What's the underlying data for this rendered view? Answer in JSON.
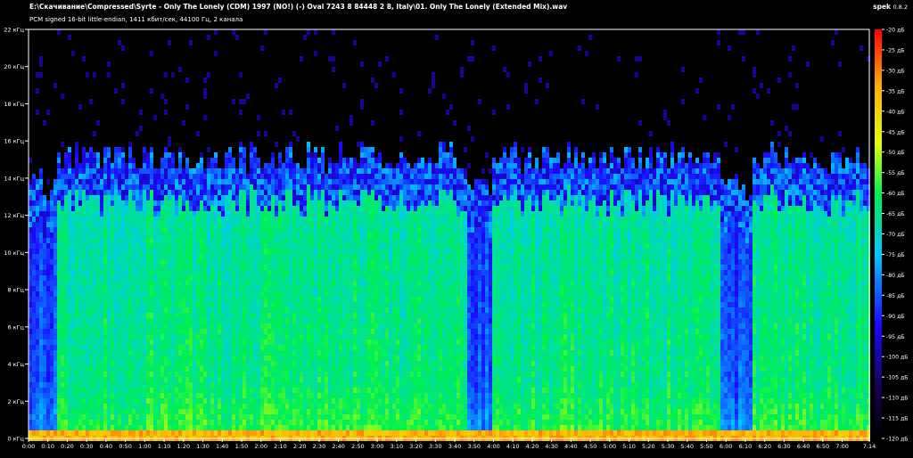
{
  "header": {
    "title": "E:\\Скачивание\\Compressed\\Syrte - Only The Lonely (CDM) 1997 (NO!) (-) Oval  7243 8 84448 2 8, Italy\\01. Only The Lonely (Extended Mix).wav",
    "subtitle": "PCM signed 16-bit little-endian, 1411 кбит/сек, 44100 Гц, 2 канала",
    "app_name": "spek",
    "app_version": "0.8.2"
  },
  "chart_data": {
    "type": "heatmap",
    "x_ticks": [
      "0:00",
      "0:10",
      "0:20",
      "0:30",
      "0:40",
      "0:50",
      "1:00",
      "1:10",
      "1:20",
      "1:30",
      "1:40",
      "1:50",
      "2:00",
      "2:10",
      "2:20",
      "2:30",
      "2:40",
      "2:50",
      "3:00",
      "3:10",
      "3:20",
      "3:30",
      "3:40",
      "3:50",
      "4:00",
      "4:10",
      "4:20",
      "4:30",
      "4:40",
      "4:50",
      "5:00",
      "5:10",
      "5:20",
      "5:30",
      "5:40",
      "5:50",
      "6:00",
      "6:10",
      "6:20",
      "6:30",
      "6:40",
      "6:50",
      "7:00",
      "7:14"
    ],
    "y_ticks": [
      "0 кГц",
      "2 кГц",
      "4 кГц",
      "6 кГц",
      "8 кГц",
      "10 кГц",
      "12 кГц",
      "14 кГц",
      "16 кГц",
      "18 кГц",
      "20 кГц",
      "22 кГц"
    ],
    "legend_ticks": [
      "-20 дБ",
      "-25 дБ",
      "-30 дБ",
      "-35 дБ",
      "-40 дБ",
      "-45 дБ",
      "-50 дБ",
      "-55 дБ",
      "-60 дБ",
      "-65 дБ",
      "-70 дБ",
      "-75 дБ",
      "-80 дБ",
      "-85 дБ",
      "-90 дБ",
      "-95 дБ",
      "-100 дБ",
      "-105 дБ",
      "-110 дБ",
      "-115 дБ",
      "-120 дБ"
    ],
    "x_range": [
      "0:00",
      "7:14"
    ],
    "y_range_khz": [
      0,
      22
    ],
    "db_range": [
      -120,
      -20
    ],
    "cutoff_khz": 15.5,
    "legend_position": "right",
    "colors": {
      "background": "#000000",
      "scale": [
        "#000000",
        "#160050",
        "#1a0aff",
        "#00c8ff",
        "#00f050",
        "#e0ff00",
        "#ffb000",
        "#ff0000"
      ]
    }
  }
}
